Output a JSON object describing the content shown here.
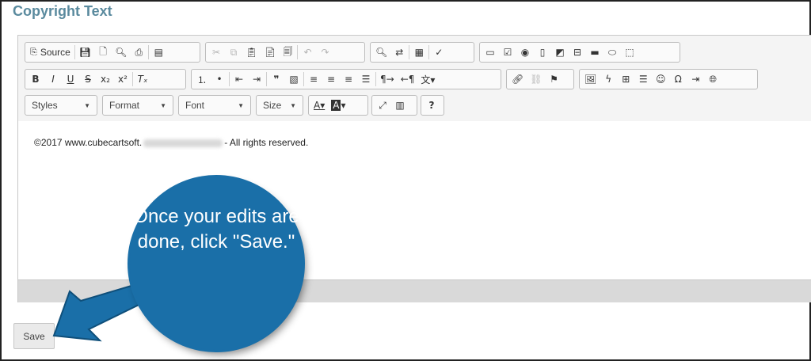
{
  "page": {
    "title": "Copyright Text"
  },
  "toolbar": {
    "source_label": "Source",
    "combos": [
      {
        "label": "Styles"
      },
      {
        "label": "Format"
      },
      {
        "label": "Font"
      },
      {
        "label": "Size"
      }
    ]
  },
  "editor": {
    "content_before": "©2017 www.cubecartsoft.",
    "content_after": "- All rights reserved."
  },
  "callout": {
    "text": "Once your edits are done, click \"Save.\""
  },
  "save_label": "Save",
  "colors": {
    "title": "#5a8a9e",
    "callout": "#1a6fa8"
  }
}
